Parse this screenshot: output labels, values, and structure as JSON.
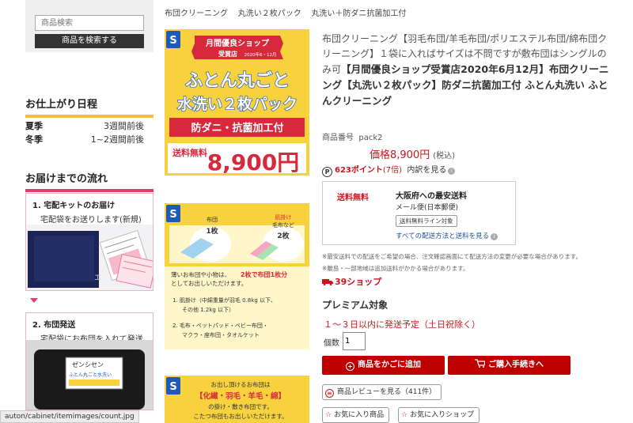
{
  "search": {
    "placeholder": "商品検索",
    "button_label": "商品を検索する"
  },
  "finish_schedule": {
    "title": "お仕上がり日程",
    "rows": [
      {
        "season": "夏季",
        "duration": "3週間前後"
      },
      {
        "season": "冬季",
        "duration": "1~2週間前後"
      }
    ]
  },
  "delivery_flow": {
    "title": "お届けまでの流れ",
    "steps": [
      {
        "title": "1. 宅配キットのお届け",
        "subtitle": "宅配袋をお送りします(新規)",
        "bag_label": "エ"
      },
      {
        "title": "2. 布団発送",
        "subtitle": "宅配袋にお布団を入れて発送",
        "bag_label_1": "ゼンシセン",
        "bag_label_2": "ふとん丸ごと水洗い"
      }
    ]
  },
  "status_bar": {
    "url": "auton/cabinet/itemimages/count.jpg"
  },
  "breadcrumb": [
    "布団クリーニング",
    "丸洗い２枚パック",
    "丸洗い＋防ダニ抗菌加工付"
  ],
  "banner1": {
    "logo": "S",
    "award_line1": "月間優良ショップ",
    "award_line2": "受賞店",
    "award_date": "2020年6・12月",
    "headline1": "ふとん丸ごと",
    "headline2": "水洗い２枚パック",
    "feature": "防ダニ・抗菌加工付",
    "shipping_label": "送料無料",
    "price": "8,900円"
  },
  "banner2": {
    "logo": "S",
    "item1_label": "布団",
    "item1_count": "1枚",
    "item2_label1": "肌掛け",
    "item2_label2": "毛布など",
    "item2_count": "2枚",
    "desc_prefix": "薄いお布団や小物は、",
    "desc_highlight": "2枚で布団1枚分",
    "desc_suffix": "としてお出しいただけます。",
    "list1_line1": "1. 肌掛け（中綿重量が羽毛 0.8kg 以下、",
    "list1_line2": "その他 1.2kg 以下）",
    "list2_line1": "2. 毛布・ベットパッド・ベビー布団・",
    "list2_line2": "マクラ・座布団・タオルケット"
  },
  "banner3": {
    "logo": "S",
    "intro": "お出し頂けるお布団は",
    "materials": "【化繊・羽毛・羊毛・綿】",
    "desc1": "の掛け・敷き布団です。",
    "desc2": "こたつ布団もお出しいただけます。"
  },
  "product": {
    "title_plain": "布団クリーニング【羽毛布団/羊毛布団/ポリエステル布団/綿布団クリーニング】１袋に入ればサイズは不問ですが敷布団はシングルのみ可",
    "title_bold": "【月間優良ショップ受賞店2020年6月12月】布団クリーニング【丸洗い２枚パック】防ダニ抗菌加工付 ふとん丸洗い ふとんクリーニング",
    "code_label": "商品番号",
    "code": "pack2",
    "price": "価格8,900円",
    "tax": "(税込)",
    "points_badge": "P",
    "points": "623ポイント",
    "points_multiplier": "(7倍)",
    "points_detail": "内訳を見る"
  },
  "shipping": {
    "free_label": "送料無料",
    "title": "大阪府への最安送料",
    "carrier": "メール便(日本郵便)",
    "chip": "送料無料ライン対象",
    "link": "すべての配送方法と送料を見る"
  },
  "notes": [
    "※最安送料での配送をご希望の場合、注文確認画面にて配送方法の変更が必要な場合があります。",
    "※離島・一部地域は追加送料がかかる場合があります。"
  ],
  "shop_count": "39ショップ",
  "premium_label": "プレミアム対象",
  "delivery_estimate": "１～３日以内に発送予定（土日祝除く）",
  "quantity": {
    "label": "個数",
    "value": "1"
  },
  "buttons": {
    "add_to_cart": "商品をかごに追加",
    "checkout": "ご購入手続きへ",
    "reviews": "商品レビューを見る（411件）",
    "favorite_item": "お気に入り商品",
    "favorite_shop": "お気に入りショップ"
  },
  "colors": {
    "accent_red": "#bf0000",
    "banner_yellow": "#f7d23e",
    "section_pink": "#e83b6d",
    "section_yellow": "#f2c233",
    "logo_blue": "#1f5ab8"
  }
}
